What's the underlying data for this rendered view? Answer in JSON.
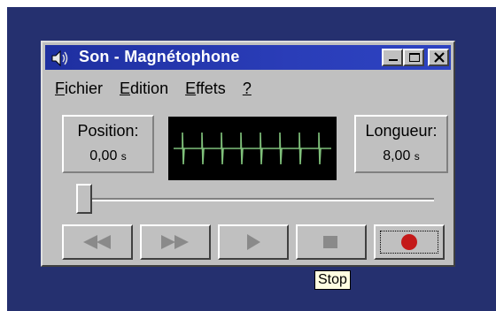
{
  "window": {
    "title": "Son - Magnétophone",
    "buttons": {
      "minimize": "minimize-icon",
      "maximize": "maximize-icon",
      "close": "close-icon"
    }
  },
  "menu": {
    "items": [
      {
        "label": "Fichier",
        "accel": "F",
        "rest": "ichier"
      },
      {
        "label": "Edition",
        "accel": "E",
        "rest": "dition"
      },
      {
        "label": "Effets",
        "accel": "E",
        "rest": "ffets"
      },
      {
        "label": "?",
        "accel": "?",
        "rest": ""
      }
    ]
  },
  "position": {
    "label": "Position:",
    "value": "0,00",
    "unit": "s"
  },
  "length": {
    "label": "Longueur:",
    "value": "8,00",
    "unit": "s"
  },
  "slider": {
    "value": 0
  },
  "controls": [
    {
      "name": "rewind-button",
      "icon": "rewind-icon"
    },
    {
      "name": "fast-forward-button",
      "icon": "fast-forward-icon"
    },
    {
      "name": "play-button",
      "icon": "play-icon"
    },
    {
      "name": "stop-button",
      "icon": "stop-icon"
    },
    {
      "name": "record-button",
      "icon": "record-icon"
    }
  ],
  "tooltip": {
    "text": "Stop"
  },
  "colors": {
    "desktop": "#25306f",
    "titlebar": "#1e2fa0",
    "waveform": "#7fc07a",
    "record": "#c41a1a"
  }
}
